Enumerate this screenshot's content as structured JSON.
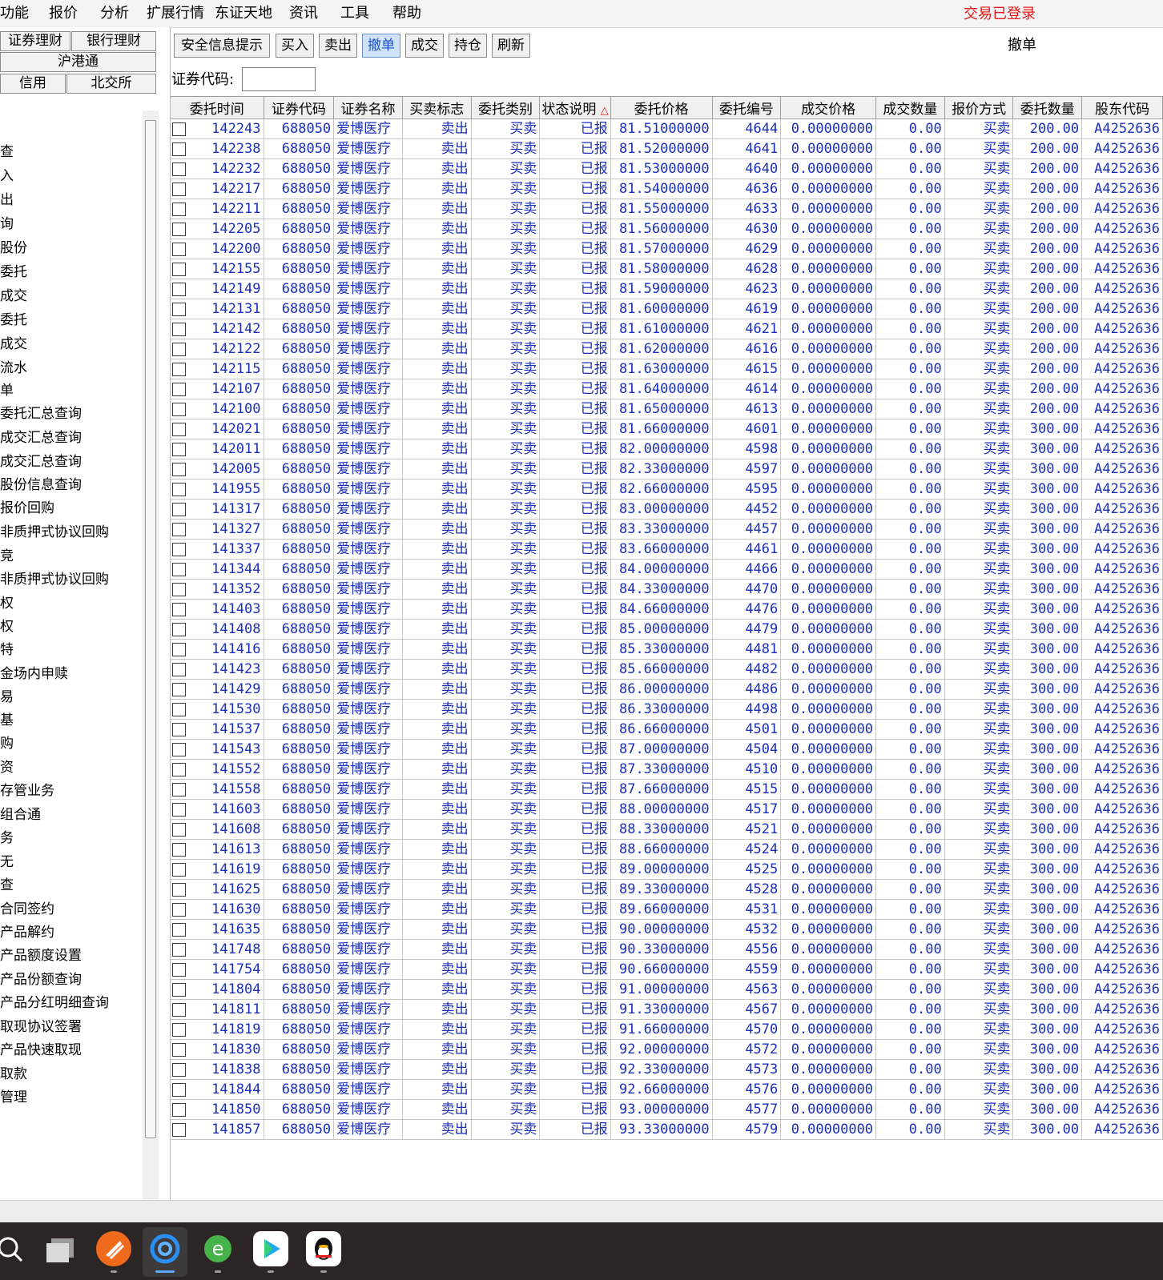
{
  "menu": {
    "items": [
      "功能",
      "报价",
      "分析",
      "扩展行情",
      "东证天地",
      "资讯",
      "工具",
      "帮助"
    ],
    "login_status": "交易已登录"
  },
  "left_panel": {
    "categories": [
      "证券理财",
      "银行理财",
      "沪港通",
      "信用",
      "北交所"
    ],
    "nav_items": [
      "查",
      "入",
      "出",
      "询",
      "股份",
      "委托",
      "成交",
      "委托",
      "成交",
      "流水",
      "单",
      "委托汇总查询",
      "成交汇总查询",
      "成交汇总查询",
      "股份信息查询",
      "报价回购",
      "非质押式协议回购",
      "竞",
      "非质押式协议回购",
      "权",
      "权",
      "特",
      "金场内申赎",
      "易",
      "基",
      "购",
      "资",
      "存管业务",
      "组合通",
      "务",
      "无",
      "查",
      "合同签约",
      "产品解约",
      "产品额度设置",
      "产品份额查询",
      "产品分红明细查询",
      "取现协议签署",
      "产品快速取现",
      "取款",
      "管理"
    ]
  },
  "toolbar": {
    "buttons": [
      "安全信息提示",
      "买入",
      "卖出",
      "撤单",
      "成交",
      "持仓",
      "刷新"
    ],
    "page_title": "撤单",
    "code_label": "证券代码:",
    "code_value": ""
  },
  "table": {
    "columns": [
      "委托时间",
      "证券代码",
      "证券名称",
      "买卖标志",
      "委托类别",
      "状态说明",
      "委托价格",
      "委托编号",
      "成交价格",
      "成交数量",
      "报价方式",
      "委托数量",
      "股东代码"
    ],
    "sort_mark": "△",
    "common": {
      "code": "688050",
      "name": "爱博医疗",
      "side": "卖出",
      "category": "买卖",
      "status": "已报",
      "deal_price": "0.00000000",
      "deal_qty": "0.00",
      "quote_method": "买卖",
      "account": "A4252636"
    },
    "rows": [
      [
        "142243",
        "81.51000000",
        "4644",
        "200.00"
      ],
      [
        "142238",
        "81.52000000",
        "4641",
        "200.00"
      ],
      [
        "142232",
        "81.53000000",
        "4640",
        "200.00"
      ],
      [
        "142217",
        "81.54000000",
        "4636",
        "200.00"
      ],
      [
        "142211",
        "81.55000000",
        "4633",
        "200.00"
      ],
      [
        "142205",
        "81.56000000",
        "4630",
        "200.00"
      ],
      [
        "142200",
        "81.57000000",
        "4629",
        "200.00"
      ],
      [
        "142155",
        "81.58000000",
        "4628",
        "200.00"
      ],
      [
        "142149",
        "81.59000000",
        "4623",
        "200.00"
      ],
      [
        "142131",
        "81.60000000",
        "4619",
        "200.00"
      ],
      [
        "142142",
        "81.61000000",
        "4621",
        "200.00"
      ],
      [
        "142122",
        "81.62000000",
        "4616",
        "200.00"
      ],
      [
        "142115",
        "81.63000000",
        "4615",
        "200.00"
      ],
      [
        "142107",
        "81.64000000",
        "4614",
        "200.00"
      ],
      [
        "142100",
        "81.65000000",
        "4613",
        "200.00"
      ],
      [
        "142021",
        "81.66000000",
        "4601",
        "300.00"
      ],
      [
        "142011",
        "82.00000000",
        "4598",
        "300.00"
      ],
      [
        "142005",
        "82.33000000",
        "4597",
        "300.00"
      ],
      [
        "141955",
        "82.66000000",
        "4595",
        "300.00"
      ],
      [
        "141317",
        "83.00000000",
        "4452",
        "300.00"
      ],
      [
        "141327",
        "83.33000000",
        "4457",
        "300.00"
      ],
      [
        "141337",
        "83.66000000",
        "4461",
        "300.00"
      ],
      [
        "141344",
        "84.00000000",
        "4466",
        "300.00"
      ],
      [
        "141352",
        "84.33000000",
        "4470",
        "300.00"
      ],
      [
        "141403",
        "84.66000000",
        "4476",
        "300.00"
      ],
      [
        "141408",
        "85.00000000",
        "4479",
        "300.00"
      ],
      [
        "141416",
        "85.33000000",
        "4481",
        "300.00"
      ],
      [
        "141423",
        "85.66000000",
        "4482",
        "300.00"
      ],
      [
        "141429",
        "86.00000000",
        "4486",
        "300.00"
      ],
      [
        "141530",
        "86.33000000",
        "4498",
        "300.00"
      ],
      [
        "141537",
        "86.66000000",
        "4501",
        "300.00"
      ],
      [
        "141543",
        "87.00000000",
        "4504",
        "300.00"
      ],
      [
        "141552",
        "87.33000000",
        "4510",
        "300.00"
      ],
      [
        "141558",
        "87.66000000",
        "4515",
        "300.00"
      ],
      [
        "141603",
        "88.00000000",
        "4517",
        "300.00"
      ],
      [
        "141608",
        "88.33000000",
        "4521",
        "300.00"
      ],
      [
        "141613",
        "88.66000000",
        "4524",
        "300.00"
      ],
      [
        "141619",
        "89.00000000",
        "4525",
        "300.00"
      ],
      [
        "141625",
        "89.33000000",
        "4528",
        "300.00"
      ],
      [
        "141630",
        "89.66000000",
        "4531",
        "300.00"
      ],
      [
        "141635",
        "90.00000000",
        "4532",
        "300.00"
      ],
      [
        "141748",
        "90.33000000",
        "4556",
        "300.00"
      ],
      [
        "141754",
        "90.66000000",
        "4559",
        "300.00"
      ],
      [
        "141804",
        "91.00000000",
        "4563",
        "300.00"
      ],
      [
        "141811",
        "91.33000000",
        "4567",
        "300.00"
      ],
      [
        "141819",
        "91.66000000",
        "4570",
        "300.00"
      ],
      [
        "141830",
        "92.00000000",
        "4572",
        "300.00"
      ],
      [
        "141838",
        "92.33000000",
        "4573",
        "300.00"
      ],
      [
        "141844",
        "92.66000000",
        "4576",
        "300.00"
      ],
      [
        "141850",
        "93.00000000",
        "4577",
        "300.00"
      ],
      [
        "141857",
        "93.33000000",
        "4579",
        "300.00"
      ]
    ]
  },
  "taskbar": {
    "icons": [
      "search-icon",
      "task-view-icon",
      "app-orange-icon",
      "app-blue-swirl-icon",
      "browser-e-icon",
      "video-player-icon",
      "qq-penguin-icon"
    ]
  },
  "colors": {
    "cell_text": "#1b2fb8",
    "login_status": "#e81616",
    "active_button_bg": "#cfe3fb",
    "taskbar_bg": "#2b2526"
  }
}
